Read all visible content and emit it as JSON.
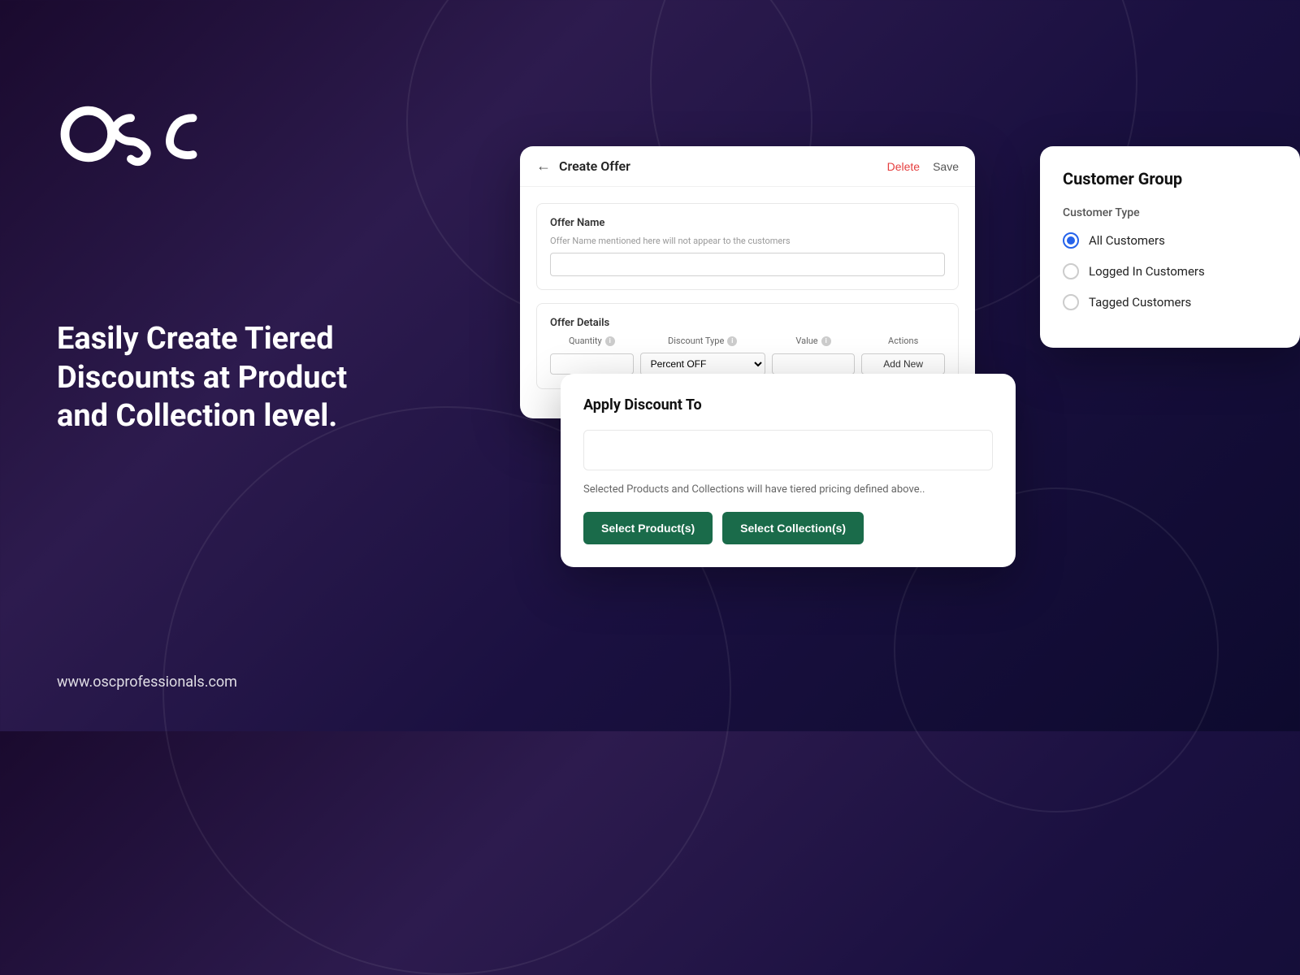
{
  "background": {
    "gradient_start": "#1a0a2e",
    "gradient_end": "#0d0a2e"
  },
  "logo": {
    "alt": "OSC Logo"
  },
  "tagline": "Easily Create Tiered Discounts at Product and Collection level.",
  "website": "www.oscprofessionals.com",
  "create_offer_card": {
    "back_label": "←",
    "title": "Create Offer",
    "delete_label": "Delete",
    "save_label": "Save",
    "offer_name_section": {
      "label": "Offer Name",
      "hint": "Offer Name mentioned here will not appear to the customers",
      "placeholder": ""
    },
    "offer_details_section": {
      "label": "Offer Details",
      "columns": {
        "quantity": "Quantity",
        "discount_type": "Discount Type",
        "value": "Value",
        "actions": "Actions"
      },
      "discount_type_default": "Percent OFF",
      "add_new_label": "Add New"
    }
  },
  "customer_group_card": {
    "title": "Customer Group",
    "subtitle": "Customer Type",
    "options": [
      {
        "label": "All Customers",
        "selected": true
      },
      {
        "label": "Logged In Customers",
        "selected": false
      },
      {
        "label": "Tagged Customers",
        "selected": false
      }
    ]
  },
  "apply_discount_card": {
    "title": "Apply Discount To",
    "hint": "Selected Products and Collections will have tiered pricing defined above..",
    "select_products_label": "Select Product(s)",
    "select_collections_label": "Select Collection(s)"
  }
}
